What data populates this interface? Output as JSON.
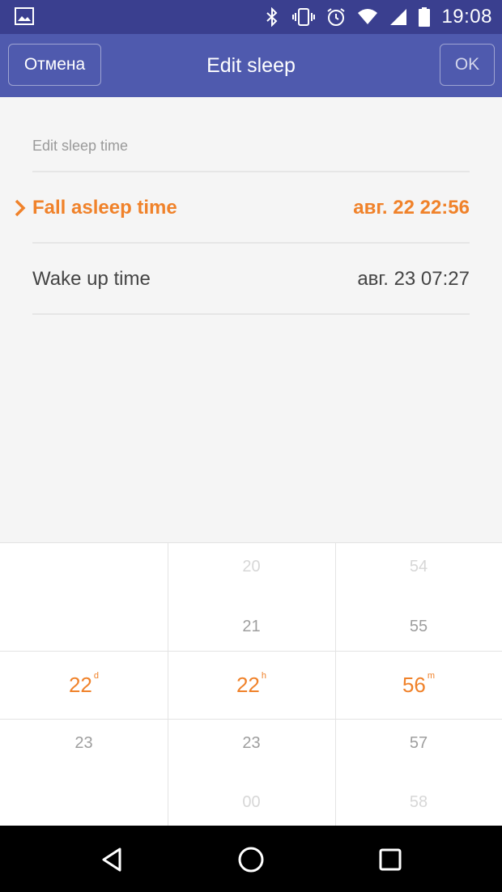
{
  "status_bar": {
    "time": "19:08",
    "icons": [
      "image-notification-icon",
      "bluetooth-icon",
      "vibrate-icon",
      "alarm-icon",
      "wifi-icon",
      "signal-icon",
      "battery-icon"
    ]
  },
  "app_bar": {
    "title": "Edit sleep",
    "cancel_label": "Отмена",
    "ok_label": "OK"
  },
  "section": {
    "label": "Edit sleep time"
  },
  "rows": [
    {
      "label": "Fall asleep time",
      "value": "авг. 22 22:56",
      "active": true
    },
    {
      "label": "Wake up time",
      "value": "авг. 23 07:27",
      "active": false
    }
  ],
  "picker": {
    "day": {
      "above2": "",
      "above1": "",
      "selected": "22",
      "unit": "d",
      "below1": "23",
      "below2": ""
    },
    "hour": {
      "above2": "20",
      "above1": "21",
      "selected": "22",
      "unit": "h",
      "below1": "23",
      "below2": "00"
    },
    "minute": {
      "above2": "54",
      "above1": "55",
      "selected": "56",
      "unit": "m",
      "below1": "57",
      "below2": "58"
    }
  },
  "colors": {
    "status_bar": "#3a3f8f",
    "app_bar": "#4f5aae",
    "accent": "#f0822a",
    "background": "#f5f5f5"
  },
  "nav_bar": {
    "icons": [
      "back-icon",
      "home-icon",
      "recents-icon"
    ]
  }
}
